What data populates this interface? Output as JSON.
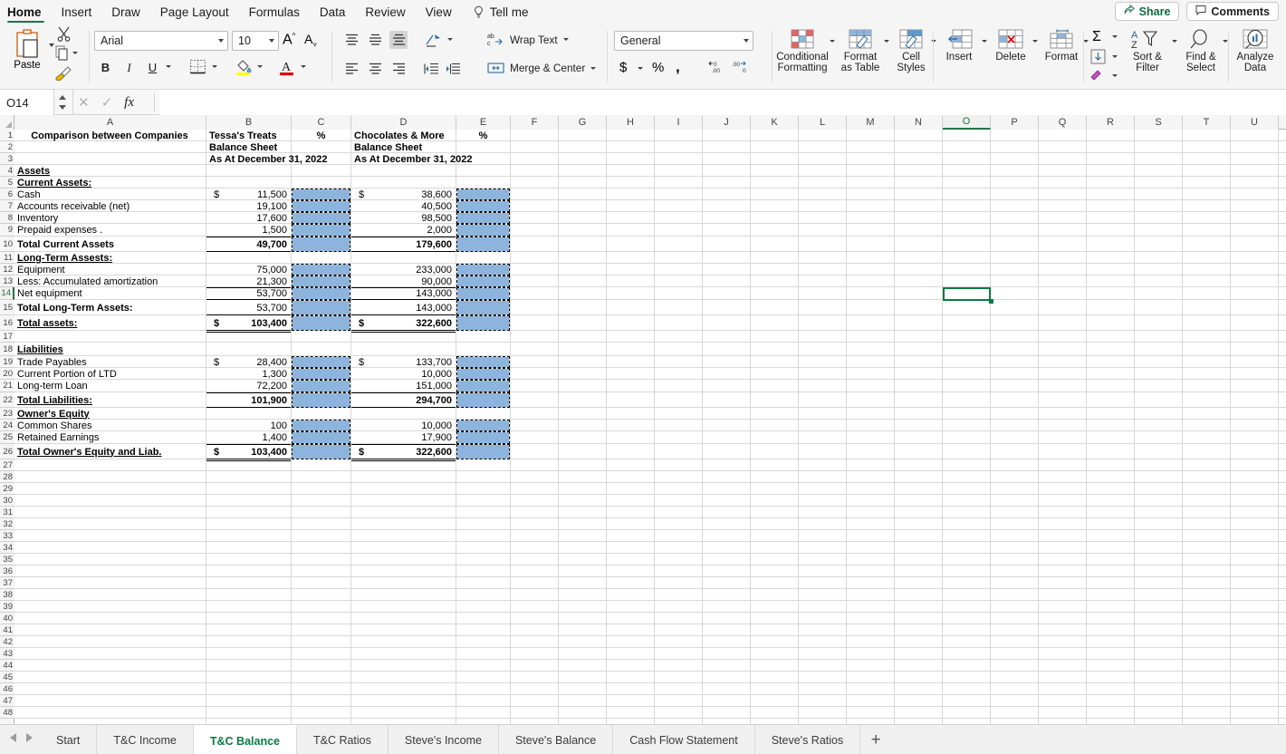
{
  "app": {
    "accent_green": "#217346",
    "fill_blue": "#8db4dc"
  },
  "menubar": {
    "items": [
      {
        "label": "Home",
        "active": true
      },
      {
        "label": "Insert",
        "active": false
      },
      {
        "label": "Draw",
        "active": false
      },
      {
        "label": "Page Layout",
        "active": false
      },
      {
        "label": "Formulas",
        "active": false
      },
      {
        "label": "Data",
        "active": false
      },
      {
        "label": "Review",
        "active": false
      },
      {
        "label": "View",
        "active": false
      }
    ],
    "tell_me": "Tell me",
    "share": "Share",
    "comments": "Comments"
  },
  "ribbon": {
    "paste_label": "Paste",
    "font_name": "Arial",
    "font_size": "10",
    "bold": "B",
    "italic": "I",
    "underline": "U",
    "wrap_text": "Wrap Text",
    "merge_center": "Merge & Center",
    "number_format": "General",
    "currency": "$",
    "percent": "%",
    "comma": ",",
    "decrease_decimal": ".00",
    "increase_decimal": ".00",
    "conditional_formatting": "Conditional\nFormatting",
    "conditional_formatting_l1": "Conditional",
    "conditional_formatting_l2": "Formatting",
    "format_as_table_l1": "Format",
    "format_as_table_l2": "as Table",
    "cell_styles_l1": "Cell",
    "cell_styles_l2": "Styles",
    "insert": "Insert",
    "delete": "Delete",
    "format": "Format",
    "sort_filter_l1": "Sort &",
    "sort_filter_l2": "Filter",
    "find_select_l1": "Find &",
    "find_select_l2": "Select",
    "analyze_data_l1": "Analyze",
    "analyze_data_l2": "Data"
  },
  "formula_bar": {
    "name_box": "O14",
    "formula": ""
  },
  "grid": {
    "columns": [
      "A",
      "B",
      "C",
      "D",
      "E",
      "F",
      "G",
      "H",
      "I",
      "J",
      "K",
      "L",
      "M",
      "N",
      "O",
      "P",
      "Q",
      "R",
      "S",
      "T",
      "U"
    ],
    "selected_column": "O",
    "selected_row": 14,
    "selected_cell": "O14",
    "rows_visible_from": 1,
    "rows_visible_to": 48,
    "cells": {
      "A1": "Comparison between Companies",
      "B1": "Tessa's Treats",
      "C1": "%",
      "D1": "Chocolates & More",
      "E1": "%",
      "B2": "Balance Sheet",
      "D2": "Balance Sheet",
      "B3": "As At December 31, 2022",
      "D3": "As At December 31, 2022",
      "A4": "Assets",
      "A5": "Current Assets:",
      "A6": "Cash",
      "B6s": "$",
      "B6": "11,500",
      "D6s": "$",
      "D6": "38,600",
      "A7": "Accounts receivable  (net)",
      "B7": "19,100",
      "D7": "40,500",
      "A8": "Inventory",
      "B8": "17,600",
      "D8": "98,500",
      "A9": "Prepaid expenses  .",
      "B9": "1,500",
      "D9": "2,000",
      "A10": "Total Current Assets",
      "B10": "49,700",
      "D10": "179,600",
      "A11": "Long-Term Assests:",
      "A12": "Equipment",
      "B12": "75,000",
      "D12": "233,000",
      "A13": "Less: Accumulated amortization",
      "B13": "21,300",
      "D13": "90,000",
      "A14": "Net equipment",
      "B14": "53,700",
      "D14": "143,000",
      "A15": "Total Long-Term Assets:",
      "B15": "53,700",
      "D15": "143,000",
      "A16": "Total assets:",
      "B16s": "$",
      "B16": "103,400",
      "D16s": "$",
      "D16": "322,600",
      "A18": "Liabilities",
      "A19": "Trade Payables",
      "B19s": "$",
      "B19": "28,400",
      "D19s": "$",
      "D19": "133,700",
      "A20": "Current Portion of LTD",
      "B20": "1,300",
      "D20": "10,000",
      "A21": "Long-term Loan",
      "B21": "72,200",
      "D21": "151,000",
      "A22": "Total Liabilities:",
      "B22": "101,900",
      "D22": "294,700",
      "A23": "Owner's Equity",
      "A24": "Common Shares",
      "B24": "100",
      "D24": "10,000",
      "A25": "Retained Earnings",
      "B25": "1,400",
      "D25": "17,900",
      "A26": "Total Owner's Equity and Liab.",
      "B26s": "$",
      "B26": "103,400",
      "D26s": "$",
      "D26": "322,600"
    }
  },
  "sheet_tabs": {
    "tabs": [
      {
        "label": "Start",
        "active": false
      },
      {
        "label": "T&C Income",
        "active": false
      },
      {
        "label": "T&C Balance",
        "active": true
      },
      {
        "label": "T&C Ratios",
        "active": false
      },
      {
        "label": "Steve's Income",
        "active": false
      },
      {
        "label": "Steve's Balance",
        "active": false
      },
      {
        "label": "Cash Flow Statement",
        "active": false
      },
      {
        "label": "Steve's Ratios",
        "active": false
      }
    ],
    "add_sheet": "+"
  }
}
